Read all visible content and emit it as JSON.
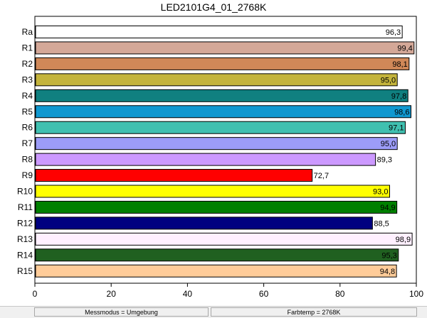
{
  "chart_data": {
    "type": "bar",
    "orientation": "horizontal",
    "title": "LED2101G4_01_2768K",
    "categories": [
      "Ra",
      "R1",
      "R2",
      "R3",
      "R4",
      "R5",
      "R6",
      "R7",
      "R8",
      "R9",
      "R10",
      "R11",
      "R12",
      "R13",
      "R14",
      "R15"
    ],
    "values": [
      96.3,
      99.4,
      98.1,
      95.0,
      97.8,
      98.6,
      97.1,
      95.0,
      89.3,
      72.7,
      93.0,
      94.9,
      88.5,
      98.9,
      95.3,
      94.8
    ],
    "value_labels": [
      "96,3",
      "99,4",
      "98,1",
      "95,0",
      "97,8",
      "98,6",
      "97,1",
      "95,0",
      "89,3",
      "72,7",
      "93,0",
      "94,9",
      "88,5",
      "98,9",
      "95,3",
      "94,8"
    ],
    "colors": [
      "#ffffff",
      "#d4a898",
      "#d08858",
      "#c4b43c",
      "#108080",
      "#1098d0",
      "#40c0b0",
      "#9c9cf8",
      "#cc99ff",
      "#ff0000",
      "#ffff00",
      "#008000",
      "#000080",
      "#fff0ff",
      "#206020",
      "#ffcc99"
    ],
    "xlim": [
      0,
      100
    ],
    "xticks": [
      0,
      20,
      40,
      60,
      80,
      100
    ],
    "xlabel": "",
    "ylabel": "",
    "grid": false,
    "legend": "none"
  },
  "status": {
    "mode": "Messmodus = Umgebung",
    "colortemp": "Farbtemp = 2768K"
  }
}
